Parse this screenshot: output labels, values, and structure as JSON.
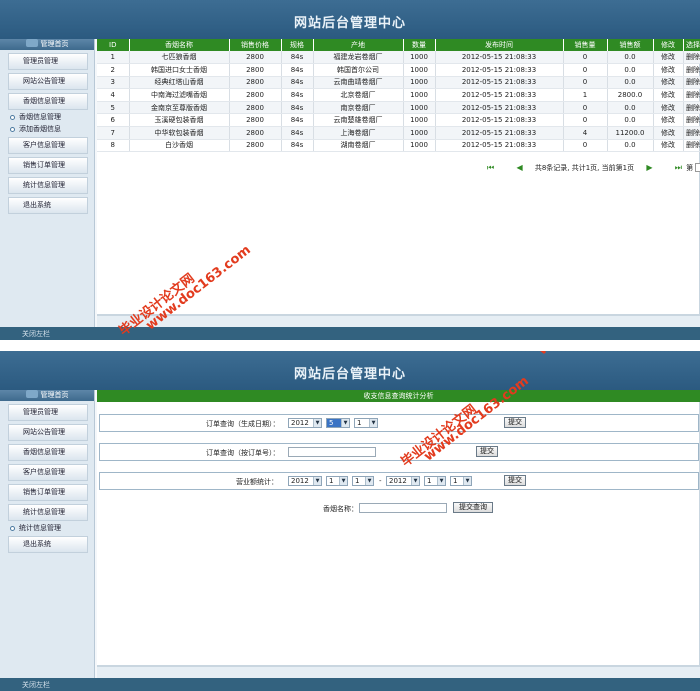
{
  "header": {
    "title": "网站后台管理中心"
  },
  "sidebar": {
    "head_label": "管理首页",
    "screen1_items": [
      {
        "type": "btn",
        "label": "管理员管理"
      },
      {
        "type": "btn",
        "label": "网站公告管理"
      },
      {
        "type": "btn",
        "label": "香烟信息管理"
      },
      {
        "type": "sub",
        "label": "香烟信息管理"
      },
      {
        "type": "sub",
        "label": "添加香烟信息"
      },
      {
        "type": "btn",
        "label": "客户信息管理"
      },
      {
        "type": "btn",
        "label": "销售订单管理"
      },
      {
        "type": "btn",
        "label": "统计信息管理"
      },
      {
        "type": "btn",
        "label": "退出系统"
      }
    ],
    "screen2_items": [
      {
        "type": "btn",
        "label": "管理员管理"
      },
      {
        "type": "btn",
        "label": "网站公告管理"
      },
      {
        "type": "btn",
        "label": "香烟信息管理"
      },
      {
        "type": "btn",
        "label": "客户信息管理"
      },
      {
        "type": "btn",
        "label": "销售订单管理"
      },
      {
        "type": "btn",
        "label": "统计信息管理"
      },
      {
        "type": "sub",
        "label": "统计信息管理"
      },
      {
        "type": "btn",
        "label": "退出系统"
      }
    ]
  },
  "footer": {
    "label": "关闭左栏"
  },
  "table": {
    "columns": [
      "ID",
      "香烟名称",
      "销售价格",
      "规格",
      "产地",
      "数量",
      "发布时间",
      "销售量",
      "销售额",
      "修改",
      "选择"
    ],
    "rows": [
      [
        "1",
        "七匹狼香烟",
        "2800",
        "84s",
        "福建龙岩卷烟厂",
        "1000",
        "2012-05-15 21:08:33",
        "0",
        "0.0",
        "修改",
        "删除"
      ],
      [
        "2",
        "韩国进口女士香烟",
        "2800",
        "84s",
        "韩国首尔公司",
        "1000",
        "2012-05-15 21:08:33",
        "0",
        "0.0",
        "修改",
        "删除"
      ],
      [
        "3",
        "经典红塔山香烟",
        "2800",
        "84s",
        "云南曲靖卷烟厂",
        "1000",
        "2012-05-15 21:08:33",
        "0",
        "0.0",
        "修改",
        "删除"
      ],
      [
        "4",
        "中南海过滤嘴香烟",
        "2800",
        "84s",
        "北京卷烟厂",
        "1000",
        "2012-05-15 21:08:33",
        "1",
        "2800.0",
        "修改",
        "删除"
      ],
      [
        "5",
        "金南京至尊版香烟",
        "2800",
        "84s",
        "南京卷烟厂",
        "1000",
        "2012-05-15 21:08:33",
        "0",
        "0.0",
        "修改",
        "删除"
      ],
      [
        "6",
        "玉溪硬包装香烟",
        "2800",
        "84s",
        "云南楚雄卷烟厂",
        "1000",
        "2012-05-15 21:08:33",
        "0",
        "0.0",
        "修改",
        "删除"
      ],
      [
        "7",
        "中华软包装香烟",
        "2800",
        "84s",
        "上海卷烟厂",
        "1000",
        "2012-05-15 21:08:33",
        "4",
        "11200.0",
        "修改",
        "删除"
      ],
      [
        "8",
        "白沙香烟",
        "2800",
        "84s",
        "湖南卷烟厂",
        "1000",
        "2012-05-15 21:08:33",
        "0",
        "0.0",
        "修改",
        "删除"
      ]
    ]
  },
  "pager": {
    "info": "共8条记录, 共计1页, 当前第1页",
    "jump_label": "第"
  },
  "stats": {
    "title": "收支信息查询统计分析",
    "order_date_label": "订单查询（生成日期）：",
    "order_date": {
      "year": "2012",
      "month": "5",
      "day": "1"
    },
    "order_no_label": "订单查询（按订单号）：",
    "order_no_value": "",
    "revenue_label": "营业额统计：",
    "revenue_from": {
      "year": "2012",
      "month": "1",
      "day": "1"
    },
    "revenue_sep": "-",
    "revenue_to": {
      "year": "2012",
      "month": "1",
      "day": "1"
    },
    "cig_name_label": "香烟名称：",
    "cig_name_value": "",
    "submit_label": "提交",
    "submit_query_label": "提交查询"
  },
  "watermark": {
    "text_a": "毕业设计论文网",
    "text_b": "www.doc163.com"
  }
}
